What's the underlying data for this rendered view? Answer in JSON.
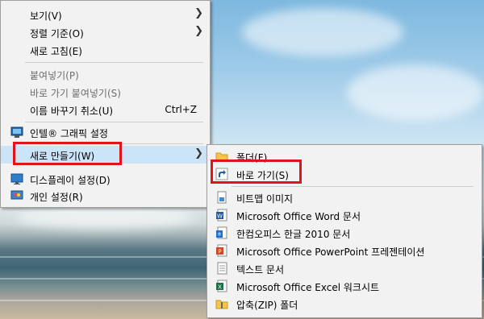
{
  "main_menu": {
    "items": [
      {
        "label": "보기(V)"
      },
      {
        "label": "정렬 기준(O)"
      },
      {
        "label": "새로 고침(E)"
      },
      {
        "label": "붙여넣기(P)"
      },
      {
        "label": "바로 가기 붙여넣기(S)"
      },
      {
        "label": "이름 바꾸기 취소(U)",
        "shortcut": "Ctrl+Z"
      },
      {
        "label": "인텔® 그래픽 설정"
      },
      {
        "label": "새로 만들기(W)"
      },
      {
        "label": "디스플레이 설정(D)"
      },
      {
        "label": "개인 설정(R)"
      }
    ]
  },
  "submenu": {
    "items": [
      {
        "label": "폴더(F)"
      },
      {
        "label": "바로 가기(S)"
      },
      {
        "label": "비트맵 이미지"
      },
      {
        "label": "Microsoft Office Word 문서"
      },
      {
        "label": "한컴오피스 한글 2010 문서"
      },
      {
        "label": "Microsoft Office PowerPoint 프레젠테이션"
      },
      {
        "label": "텍스트 문서"
      },
      {
        "label": "Microsoft Office Excel 워크시트"
      },
      {
        "label": "압축(ZIP) 폴더"
      }
    ]
  },
  "colors": {
    "highlight": "#e3131b",
    "hover": "#cce4f7"
  }
}
